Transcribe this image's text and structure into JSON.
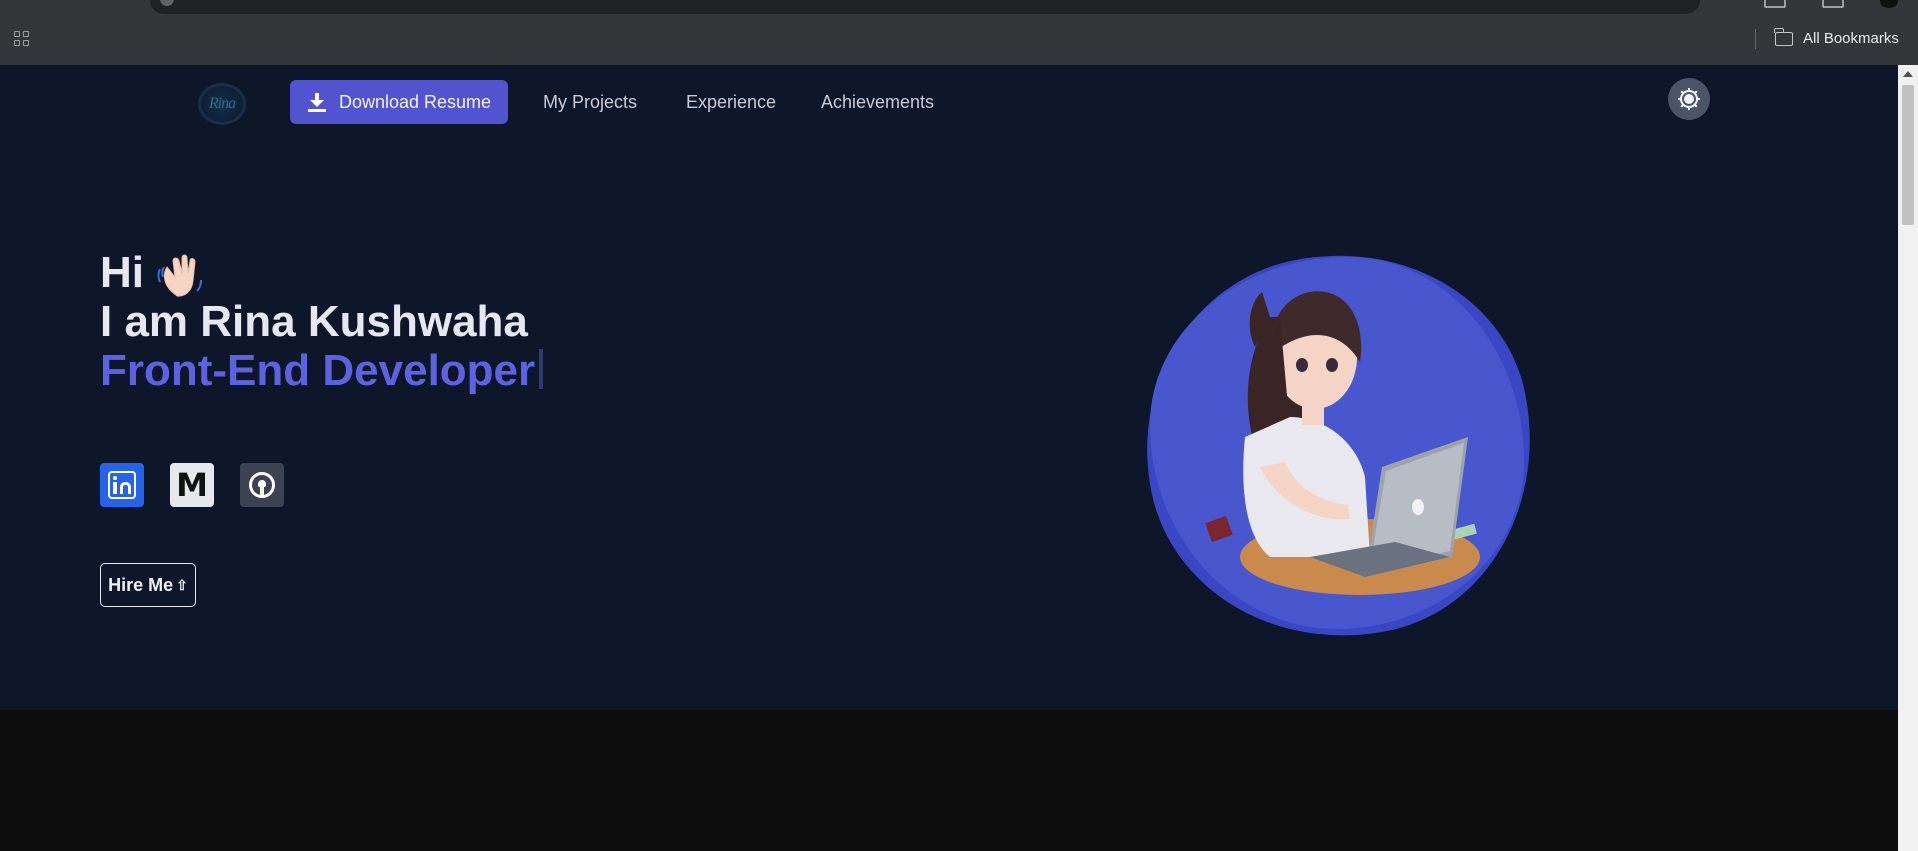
{
  "browser": {
    "bookmarks_label": "All Bookmarks"
  },
  "nav": {
    "download_label": "Download Resume",
    "links": [
      "My Projects",
      "Experience",
      "Achievements"
    ]
  },
  "hero": {
    "greeting": "Hi",
    "name_line": "I am Rina Kushwaha",
    "role": "Front-End Developer",
    "hire_label": "Hire Me"
  },
  "social": [
    "linkedin-icon",
    "gmail-icon",
    "github-icon"
  ],
  "colors": {
    "page_bg": "#0e162a",
    "accent": "#5153cf",
    "role_text": "#5d63e0",
    "blob": "#4957cf",
    "linkedin": "#2563eb"
  }
}
